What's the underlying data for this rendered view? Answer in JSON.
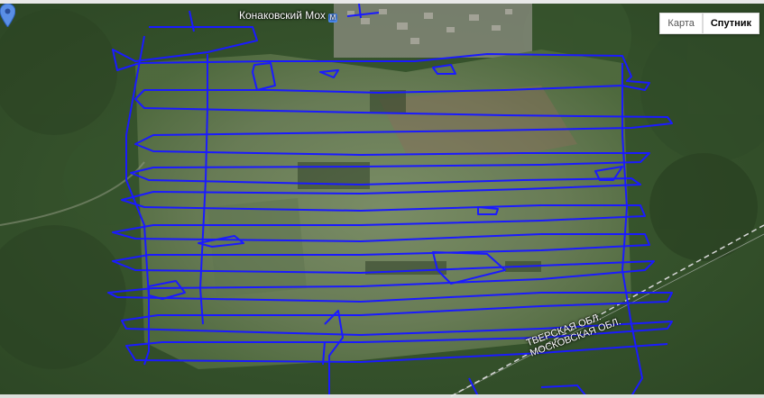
{
  "map": {
    "place_label": "Конаковский Мох",
    "place_icon": "metro-icon",
    "region_label_1": "ТВЕРСКАЯ ОБЛ.",
    "region_label_2": "МОСКОВСКАЯ ОБЛ.",
    "track_color": "#1a1aff"
  },
  "map_type": {
    "map_label": "Карта",
    "satellite_label": "Спутник",
    "selected": "Спутник"
  },
  "icons": [
    "metro-icon",
    "map-pin-icon"
  ]
}
